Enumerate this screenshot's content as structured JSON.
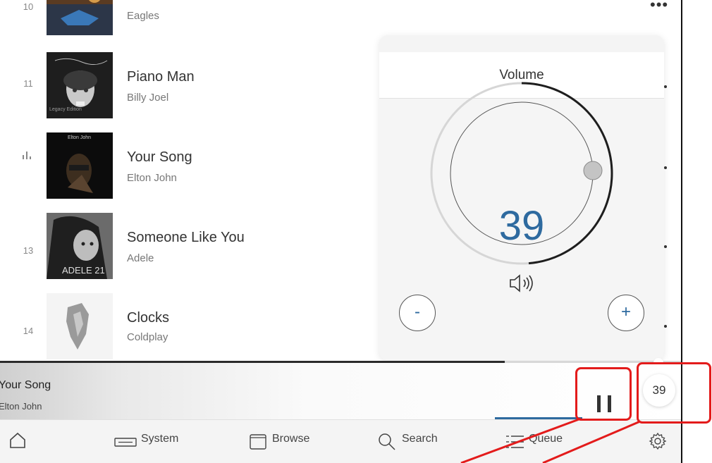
{
  "tracks": [
    {
      "number": "10",
      "title": "",
      "artist": "Eagles"
    },
    {
      "number": "11",
      "title": "Piano Man",
      "artist": "Billy Joel"
    },
    {
      "number": "",
      "title": "Your Song",
      "artist": "Elton John",
      "playing": true
    },
    {
      "number": "13",
      "title": "Someone Like You",
      "artist": "Adele"
    },
    {
      "number": "14",
      "title": "Clocks",
      "artist": "Coldplay"
    }
  ],
  "album_art_text": {
    "billy_joel": "Legacy Edition",
    "adele": "ADELE 21"
  },
  "volume": {
    "title": "Volume",
    "value": "39",
    "level_percent": 39,
    "minus_label": "-",
    "plus_label": "+",
    "accent_color": "#2e6a9f"
  },
  "now_playing": {
    "title": "Your Song",
    "artist": "Elton John",
    "progress_fraction": 0.74,
    "volume_badge": "39"
  },
  "nav": {
    "home_icon": "home-icon",
    "system_label": "System",
    "browse_label": "Browse",
    "search_label": "Search",
    "queue_label": "Queue",
    "settings_icon": "gear-icon"
  },
  "colors": {
    "annotation": "#e31b1b",
    "accent": "#2e6a9f"
  }
}
